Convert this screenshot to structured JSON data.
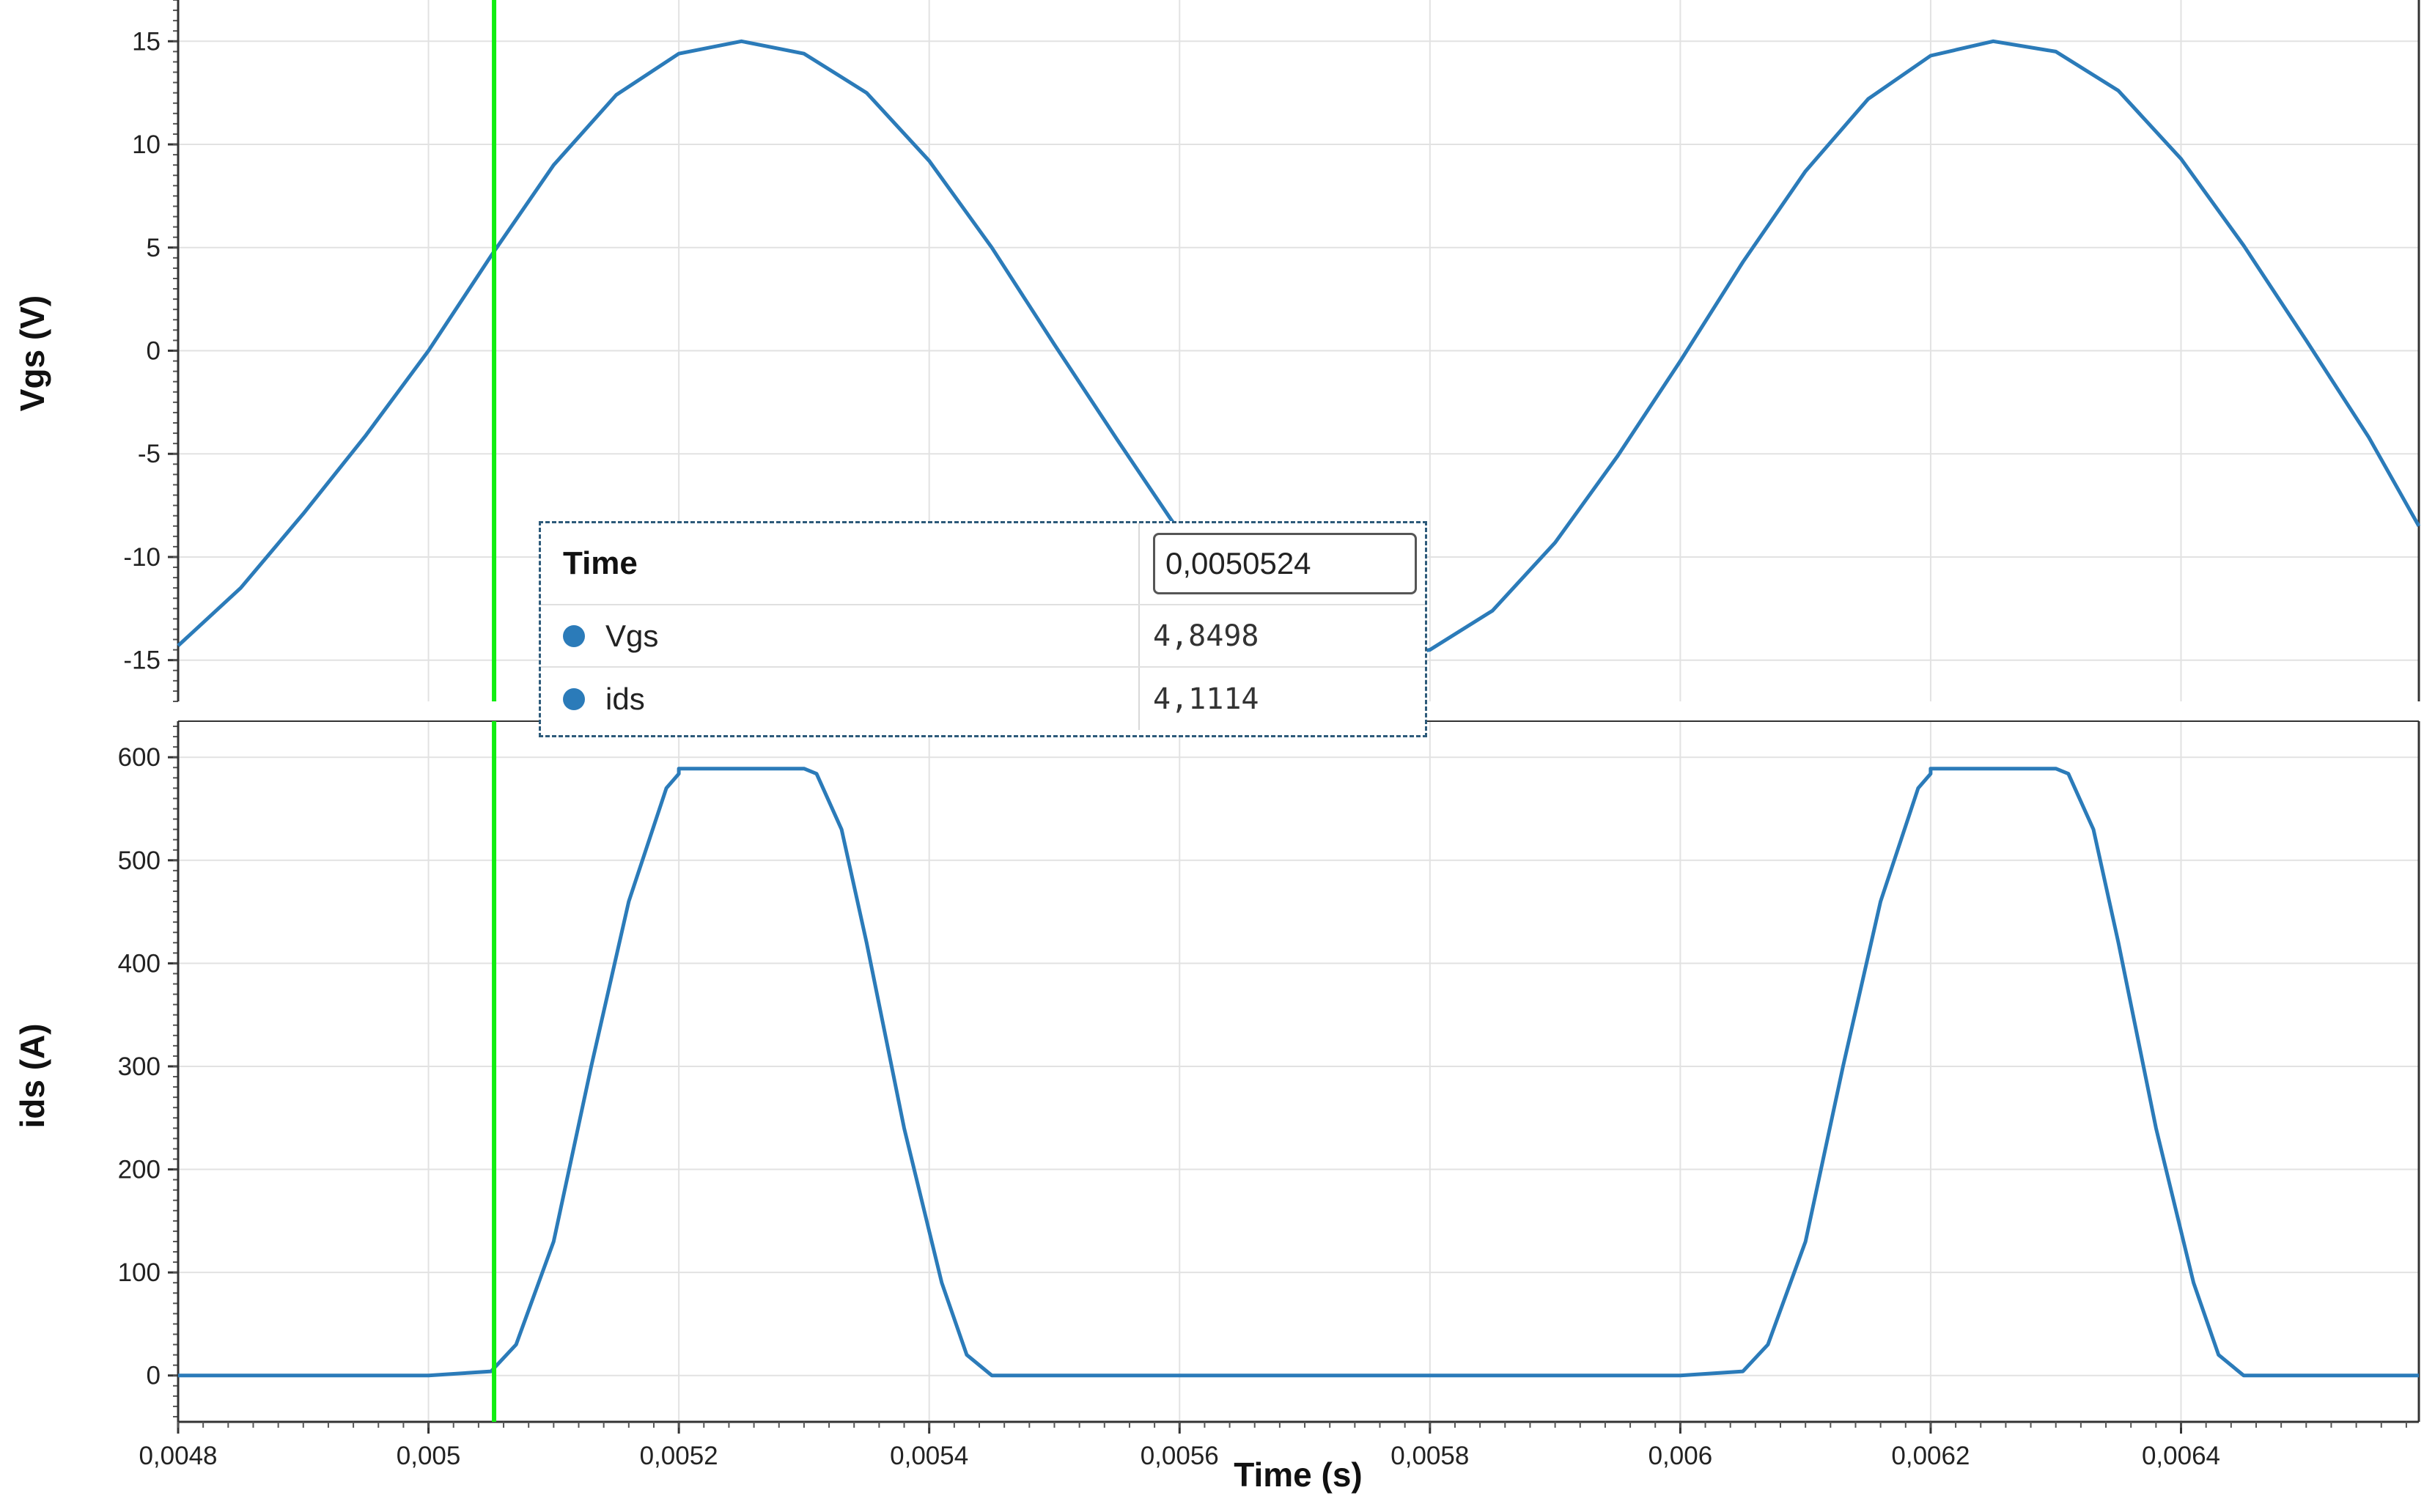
{
  "chart_data": [
    {
      "type": "line",
      "title": "",
      "xlabel": "Time (s)",
      "ylabel": "Vgs (V)",
      "xlim": [
        0.0048,
        0.00659
      ],
      "ylim": [
        -17,
        17
      ],
      "grid": true,
      "x_ticks": [
        "0,0048",
        "0,005",
        "0,0052",
        "0,0054",
        "0,0056",
        "0,0058",
        "0,006",
        "0,0062",
        "0,0064"
      ],
      "y_ticks": [
        "15",
        "10",
        "5",
        "0",
        "-5",
        "-10",
        "-15"
      ],
      "color": "#2b7bb9",
      "series": [
        {
          "name": "Vgs",
          "x": [
            0.0048,
            0.00485,
            0.0049,
            0.00495,
            0.005,
            0.00505,
            0.0051,
            0.00515,
            0.0052,
            0.00525,
            0.0053,
            0.00535,
            0.0054,
            0.00545,
            0.0055,
            0.00555,
            0.0056,
            0.00565,
            0.0057,
            0.00575,
            0.0058,
            0.00585,
            0.0059,
            0.00595,
            0.006,
            0.00605,
            0.0061,
            0.00615,
            0.0062,
            0.00625,
            0.0063,
            0.00635,
            0.0064,
            0.00645,
            0.0065,
            0.00655,
            0.00659
          ],
          "y": [
            -14.3,
            -11.5,
            -7.9,
            -4.1,
            0.0,
            4.6,
            9.0,
            12.4,
            14.4,
            15.0,
            14.4,
            12.5,
            9.2,
            5.0,
            0.3,
            -4.3,
            -8.8,
            -12.2,
            -14.3,
            -15.0,
            -14.5,
            -12.6,
            -9.3,
            -5.1,
            -0.5,
            4.3,
            8.7,
            12.2,
            14.3,
            15.0,
            14.5,
            12.6,
            9.3,
            5.1,
            0.5,
            -4.2,
            -8.5
          ]
        }
      ]
    },
    {
      "type": "line",
      "title": "",
      "xlabel": "Time (s)",
      "ylabel": "ids (A)",
      "xlim": [
        0.0048,
        0.00659
      ],
      "ylim": [
        -45,
        635
      ],
      "grid": true,
      "x_ticks": [
        "0,0048",
        "0,005",
        "0,0052",
        "0,0054",
        "0,0056",
        "0,0058",
        "0,006",
        "0,0062",
        "0,0064"
      ],
      "y_ticks": [
        "600",
        "500",
        "400",
        "300",
        "200",
        "100",
        "0"
      ],
      "color": "#2b7bb9",
      "series": [
        {
          "name": "ids",
          "x": [
            0.0048,
            0.005,
            0.00505,
            0.00507,
            0.0051,
            0.00513,
            0.00516,
            0.00519,
            0.0052,
            0.0052,
            0.0053,
            0.00531,
            0.00533,
            0.00535,
            0.00538,
            0.00541,
            0.00543,
            0.00545,
            0.006,
            0.00605,
            0.00607,
            0.0061,
            0.00613,
            0.00616,
            0.00619,
            0.0062,
            0.0062,
            0.0063,
            0.00631,
            0.00633,
            0.00635,
            0.00638,
            0.00641,
            0.00643,
            0.00645,
            0.00659
          ],
          "y": [
            0,
            0,
            4,
            30,
            130,
            300,
            460,
            570,
            584,
            589,
            589,
            584,
            530,
            420,
            240,
            90,
            20,
            0,
            0,
            4,
            30,
            130,
            300,
            460,
            570,
            584,
            589,
            589,
            584,
            530,
            420,
            240,
            90,
            20,
            0,
            0
          ]
        }
      ]
    }
  ],
  "cursor": {
    "time": 0.0050524,
    "color": "#11ee11"
  },
  "readout": {
    "time_label": "Time",
    "time_value": "0,0050524",
    "rows": [
      {
        "name": "Vgs",
        "value": "4,8498"
      },
      {
        "name": "ids",
        "value": "4,1114"
      }
    ],
    "dot_color": "#2b7bb9"
  }
}
